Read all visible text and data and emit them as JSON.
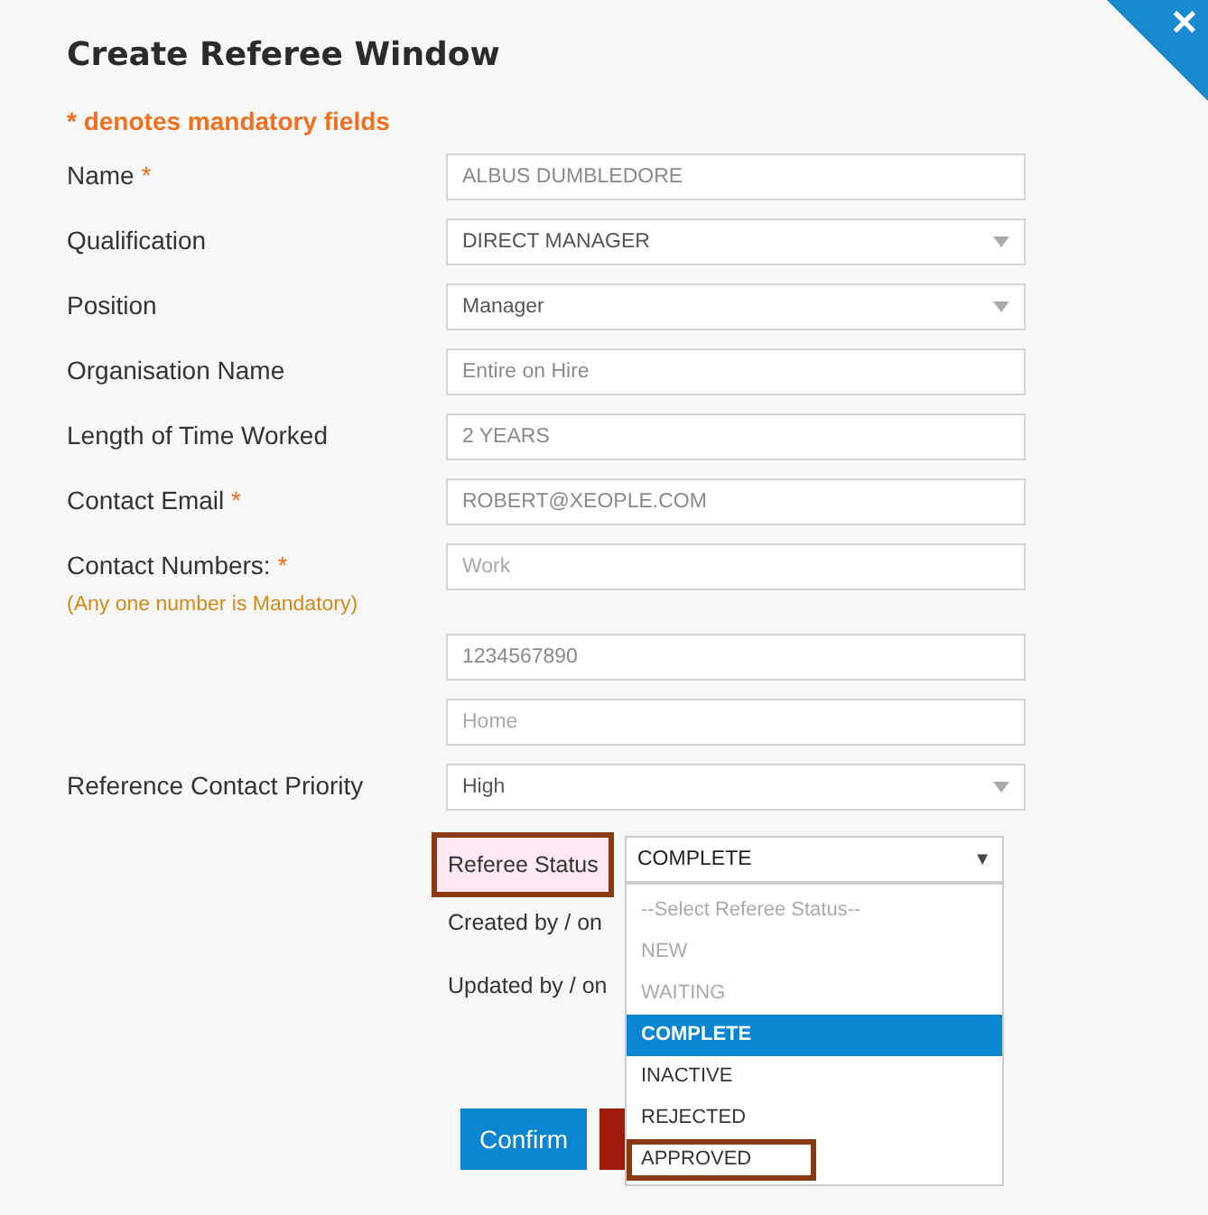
{
  "window": {
    "title": "Create Referee Window",
    "close": "✕"
  },
  "note": "* denotes mandatory fields",
  "fields": [
    {
      "label": "Name",
      "required_mark": "*",
      "kind": "text",
      "value": "ALBUS DUMBLEDORE"
    },
    {
      "label": "Qualification",
      "kind": "select",
      "value": "DIRECT MANAGER"
    },
    {
      "label": "Position",
      "kind": "select",
      "value": "Manager"
    },
    {
      "label": "Organisation Name",
      "kind": "text",
      "value": "Entire on Hire"
    },
    {
      "label": "Length of Time Worked",
      "kind": "text",
      "value": "2 YEARS"
    },
    {
      "label": "Contact Email",
      "required_mark": "*",
      "kind": "text",
      "value": "ROBERT@XEOPLE.COM"
    },
    {
      "label": "Contact Numbers:",
      "required_mark": "*",
      "kind": "text",
      "placeholder": "Work",
      "hint": "(Any one number is Mandatory)"
    },
    {
      "kind": "text",
      "value": "1234567890"
    },
    {
      "kind": "text",
      "placeholder": "Home"
    },
    {
      "label": "Reference Contact Priority",
      "kind": "select",
      "value": "High"
    }
  ],
  "referee_status": {
    "label": "Referee Status",
    "highlighted": true,
    "value": "COMPLETE",
    "caret": "▼",
    "options": [
      {
        "label": "--Select Referee Status--",
        "selected": false,
        "disabled": true,
        "highlighted": false
      },
      {
        "label": "NEW",
        "selected": false,
        "disabled": true,
        "highlighted": false
      },
      {
        "label": "WAITING",
        "selected": false,
        "disabled": true,
        "highlighted": false
      },
      {
        "label": "COMPLETE",
        "selected": true,
        "disabled": false,
        "highlighted": false
      },
      {
        "label": "INACTIVE",
        "selected": false,
        "disabled": false,
        "highlighted": false
      },
      {
        "label": "REJECTED",
        "selected": false,
        "disabled": false,
        "highlighted": false
      },
      {
        "label": "APPROVED",
        "selected": false,
        "disabled": false,
        "highlighted": true
      }
    ]
  },
  "audit": [
    {
      "label": "Created by / on"
    },
    {
      "label": "Updated by / on"
    }
  ],
  "buttons": [
    {
      "label": "Confirm",
      "kind": "primary"
    },
    {
      "kind": "danger"
    }
  ]
}
